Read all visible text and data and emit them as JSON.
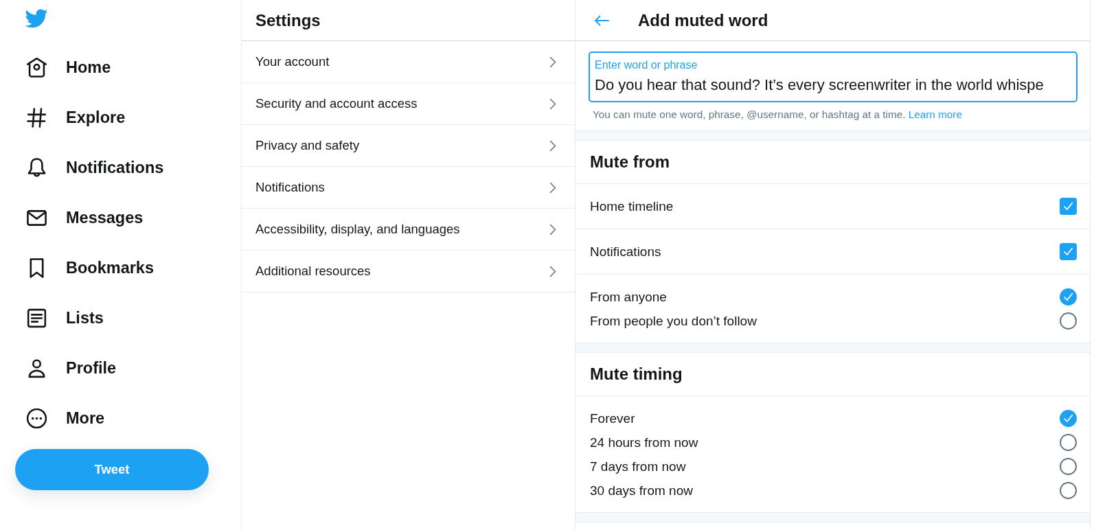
{
  "sidebar": {
    "items": [
      {
        "label": "Home",
        "selected": false
      },
      {
        "label": "Explore",
        "selected": false
      },
      {
        "label": "Notifications",
        "selected": false
      },
      {
        "label": "Messages",
        "selected": false
      },
      {
        "label": "Bookmarks",
        "selected": false
      },
      {
        "label": "Lists",
        "selected": false
      },
      {
        "label": "Profile",
        "selected": false
      },
      {
        "label": "More",
        "selected": false
      }
    ],
    "tweet_button": "Tweet"
  },
  "settings": {
    "title": "Settings",
    "items": [
      {
        "label": "Your account",
        "selected": false
      },
      {
        "label": "Security and account access",
        "selected": false
      },
      {
        "label": "Privacy and safety",
        "selected": false
      },
      {
        "label": "Notifications",
        "selected": false
      },
      {
        "label": "Accessibility, display, and languages",
        "selected": false
      },
      {
        "label": "Additional resources",
        "selected": false
      }
    ]
  },
  "muted_word": {
    "title": "Add muted word",
    "input": {
      "label": "Enter word or phrase",
      "value": "Do you hear that sound? It’s every screenwriter in the world whispe",
      "focused": true
    },
    "hint": "You can mute one word, phrase, @username, or hashtag at a time.",
    "hint_link": "Learn more"
  },
  "mute_from": {
    "title": "Mute from",
    "options": [
      {
        "label": "Home timeline",
        "checked": true
      },
      {
        "label": "Notifications",
        "checked": true
      }
    ],
    "audience": [
      {
        "label": "From anyone",
        "selected": true
      },
      {
        "label": "From people you don’t follow",
        "selected": false
      }
    ]
  },
  "mute_timing": {
    "title": "Mute timing",
    "options": [
      {
        "label": "Forever",
        "selected": true
      },
      {
        "label": "24 hours from now",
        "selected": false
      },
      {
        "label": "7 days from now",
        "selected": false
      },
      {
        "label": "30 days from now",
        "selected": false
      }
    ]
  }
}
